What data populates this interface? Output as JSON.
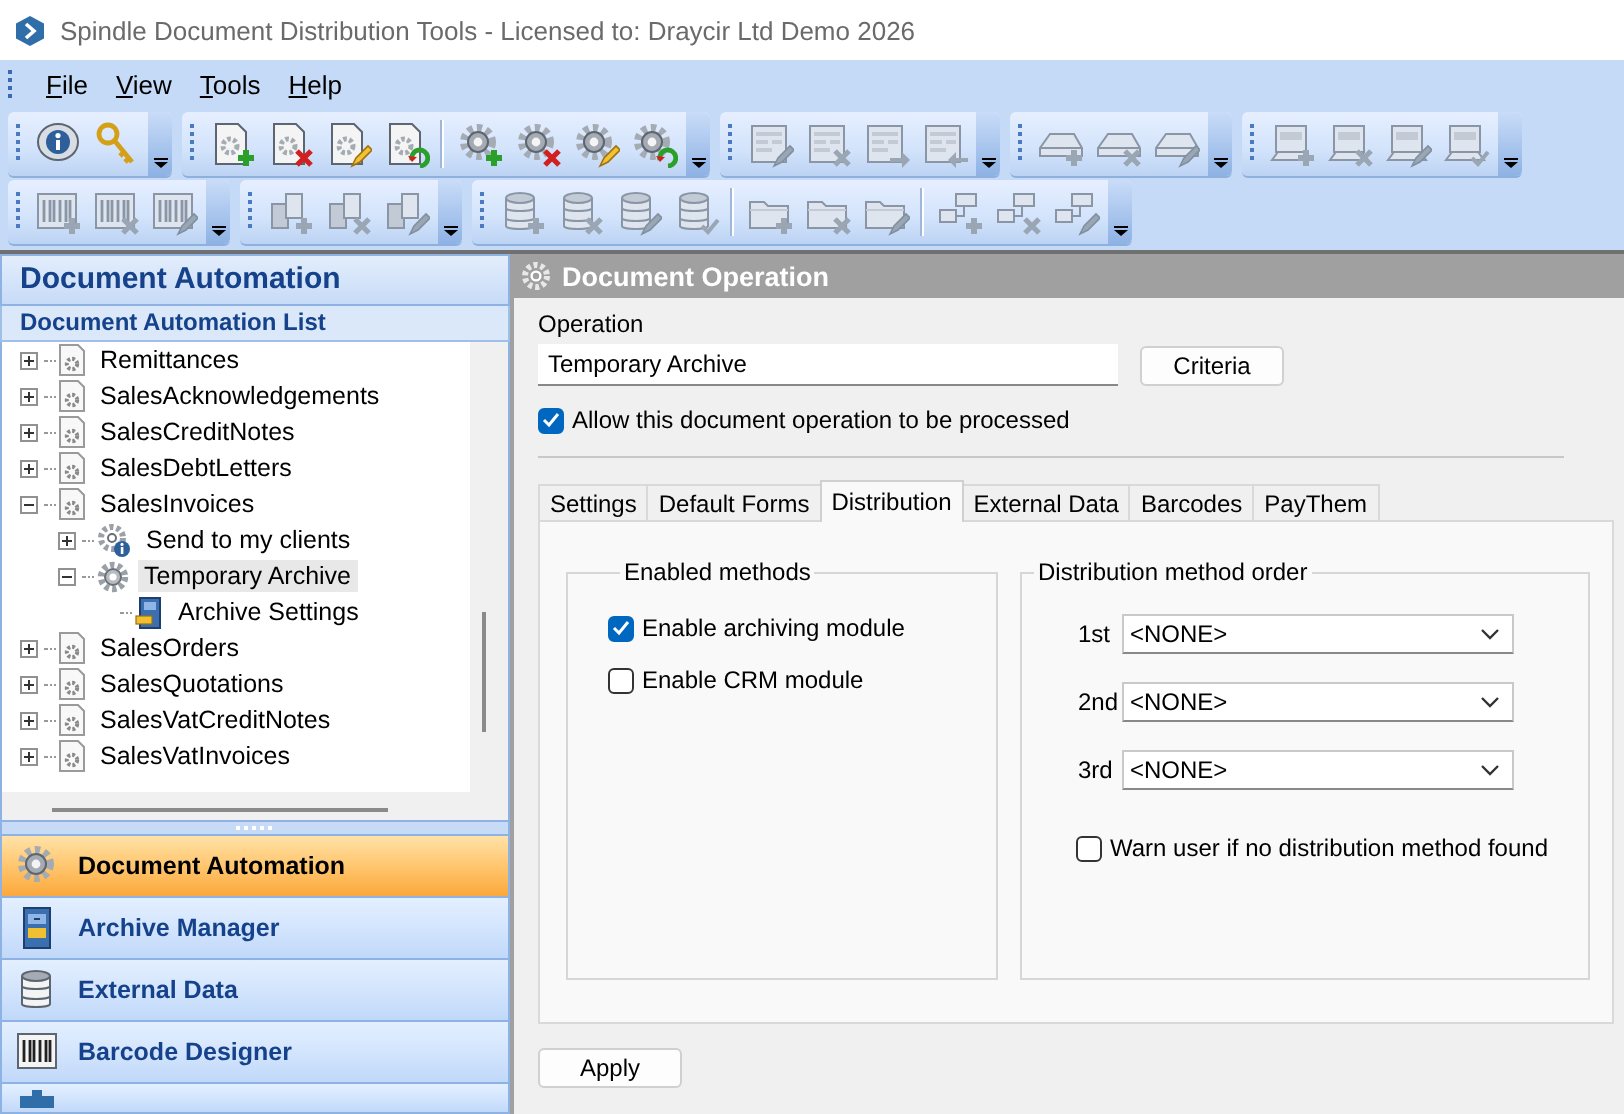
{
  "window": {
    "title": "Spindle Document Distribution Tools - Licensed to: Draycir Ltd Demo 2026"
  },
  "menu": [
    "File",
    "View",
    "Tools",
    "Help"
  ],
  "toolbars": [
    [
      {
        "sections": [
          [
            {
              "disabled": false
            },
            {
              "disabled": false
            }
          ]
        ]
      },
      {
        "sections": [
          [
            {
              "disabled": false
            },
            {
              "disabled": false
            },
            {
              "disabled": false
            },
            {
              "disabled": false
            }
          ],
          [
            {
              "disabled": false
            },
            {
              "disabled": false
            },
            {
              "disabled": false
            },
            {
              "disabled": false
            }
          ]
        ]
      },
      {
        "sections": [
          [
            {
              "disabled": true
            },
            {
              "disabled": true
            },
            {
              "disabled": true
            },
            {
              "disabled": true
            }
          ]
        ]
      },
      {
        "sections": [
          [
            {
              "disabled": true
            },
            {
              "disabled": true
            },
            {
              "disabled": true
            }
          ]
        ]
      },
      {
        "sections": [
          [
            {
              "disabled": true
            },
            {
              "disabled": true
            },
            {
              "disabled": true
            },
            {
              "disabled": true
            }
          ]
        ]
      }
    ],
    [
      {
        "sections": [
          [
            {
              "disabled": true
            },
            {
              "disabled": true
            },
            {
              "disabled": true
            }
          ]
        ]
      },
      {
        "sections": [
          [
            {
              "disabled": true
            },
            {
              "disabled": true
            },
            {
              "disabled": true
            }
          ]
        ]
      },
      {
        "sections": [
          [
            {
              "disabled": true
            },
            {
              "disabled": true
            },
            {
              "disabled": true
            },
            {
              "disabled": true
            }
          ],
          [
            {
              "disabled": true
            },
            {
              "disabled": true
            },
            {
              "disabled": true
            }
          ],
          [
            {
              "disabled": true
            },
            {
              "disabled": true
            },
            {
              "disabled": true
            }
          ]
        ]
      }
    ]
  ],
  "navigator": {
    "title": "Document Automation",
    "list_title": "Document Automation List",
    "tree": [
      {
        "label": "Remittances",
        "kind": "document",
        "expanded": false,
        "selected": false
      },
      {
        "label": "SalesAcknowledgements",
        "kind": "document",
        "expanded": false,
        "selected": false
      },
      {
        "label": "SalesCreditNotes",
        "kind": "document",
        "expanded": false,
        "selected": false
      },
      {
        "label": "SalesDebtLetters",
        "kind": "document",
        "expanded": false,
        "selected": false
      },
      {
        "label": "SalesInvoices",
        "kind": "document",
        "expanded": true,
        "selected": false,
        "children": [
          {
            "label": "Send to my clients",
            "kind": "info-operation",
            "expanded": false,
            "selected": false
          },
          {
            "label": "Temporary Archive",
            "kind": "operation",
            "expanded": true,
            "selected": true,
            "children": [
              {
                "label": "Archive Settings",
                "kind": "archive",
                "selected": false
              }
            ]
          }
        ]
      },
      {
        "label": "SalesOrders",
        "kind": "document",
        "expanded": false,
        "selected": false
      },
      {
        "label": "SalesQuotations",
        "kind": "document",
        "expanded": false,
        "selected": false
      },
      {
        "label": "SalesVatCreditNotes",
        "kind": "document",
        "expanded": false,
        "selected": false
      },
      {
        "label": "SalesVatInvoices",
        "kind": "document",
        "expanded": false,
        "selected": false
      }
    ],
    "buttons": [
      {
        "label": "Document Automation",
        "kind": "gear",
        "selected": true
      },
      {
        "label": "Archive Manager",
        "kind": "cabinet",
        "selected": false
      },
      {
        "label": "External Data",
        "kind": "database",
        "selected": false
      },
      {
        "label": "Barcode Designer",
        "kind": "barcode",
        "selected": false
      }
    ]
  },
  "operation": {
    "header": "Document Operation",
    "label": "Operation",
    "value": "Temporary Archive",
    "criteria_button": "Criteria",
    "allow": {
      "label": "Allow this document operation to be processed",
      "checked": true
    },
    "tabs": [
      {
        "label": "Settings",
        "selected": false
      },
      {
        "label": "Default Forms",
        "selected": false
      },
      {
        "label": "Distribution",
        "selected": true
      },
      {
        "label": "External Data",
        "selected": false
      },
      {
        "label": "Barcodes",
        "selected": false
      },
      {
        "label": "PayThem",
        "selected": false
      }
    ],
    "enabled_methods": {
      "title": "Enabled methods",
      "options": [
        {
          "label": "Enable archiving module",
          "checked": true
        },
        {
          "label": "Enable CRM module",
          "checked": false
        }
      ]
    },
    "method_order": {
      "title": "Distribution method order",
      "rows": [
        {
          "label": "1st",
          "value": "<NONE>"
        },
        {
          "label": "2nd",
          "value": "<NONE>"
        },
        {
          "label": "3rd",
          "value": "<NONE>"
        }
      ],
      "warn": {
        "label": "Warn user if no distribution method found",
        "checked": false
      }
    },
    "apply_button": "Apply"
  }
}
